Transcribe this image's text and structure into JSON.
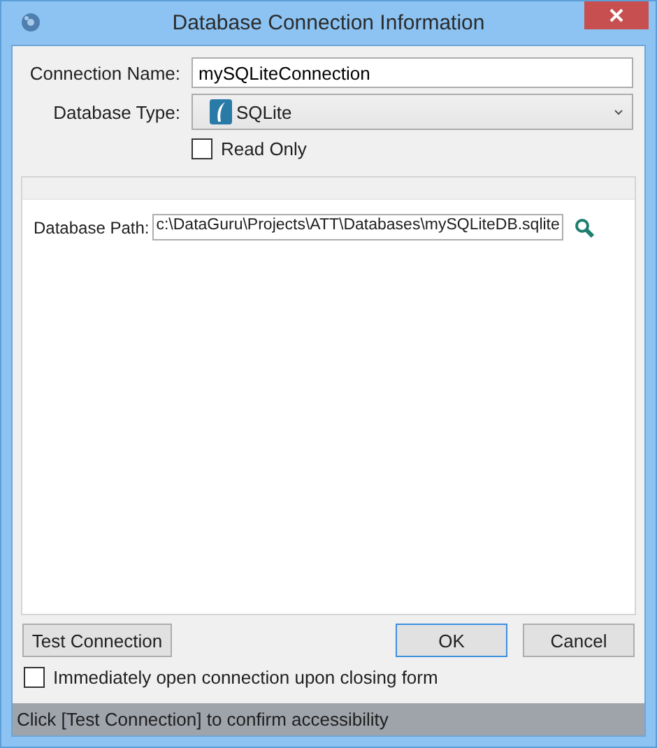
{
  "window": {
    "title": "Database Connection Information"
  },
  "connection_name": {
    "label": "Connection Name:",
    "value": "mySQLiteConnection"
  },
  "database_type": {
    "label": "Database Type:",
    "value": "SQLite"
  },
  "read_only": {
    "label": "Read Only",
    "checked": false
  },
  "database_path": {
    "label": "Database Path:",
    "value": "c:\\DataGuru\\Projects\\ATT\\Databases\\mySQLiteDB.sqlite"
  },
  "buttons": [
    {
      "label": "Test Connection",
      "kind": "left",
      "focused": false
    },
    {
      "label": "OK",
      "kind": "right",
      "focused": true
    },
    {
      "label": "Cancel",
      "kind": "right",
      "focused": false
    }
  ],
  "open_on_close": {
    "label": "Immediately open connection upon closing form",
    "checked": false
  },
  "status_bar": "Click [Test Connection] to confirm accessibility"
}
